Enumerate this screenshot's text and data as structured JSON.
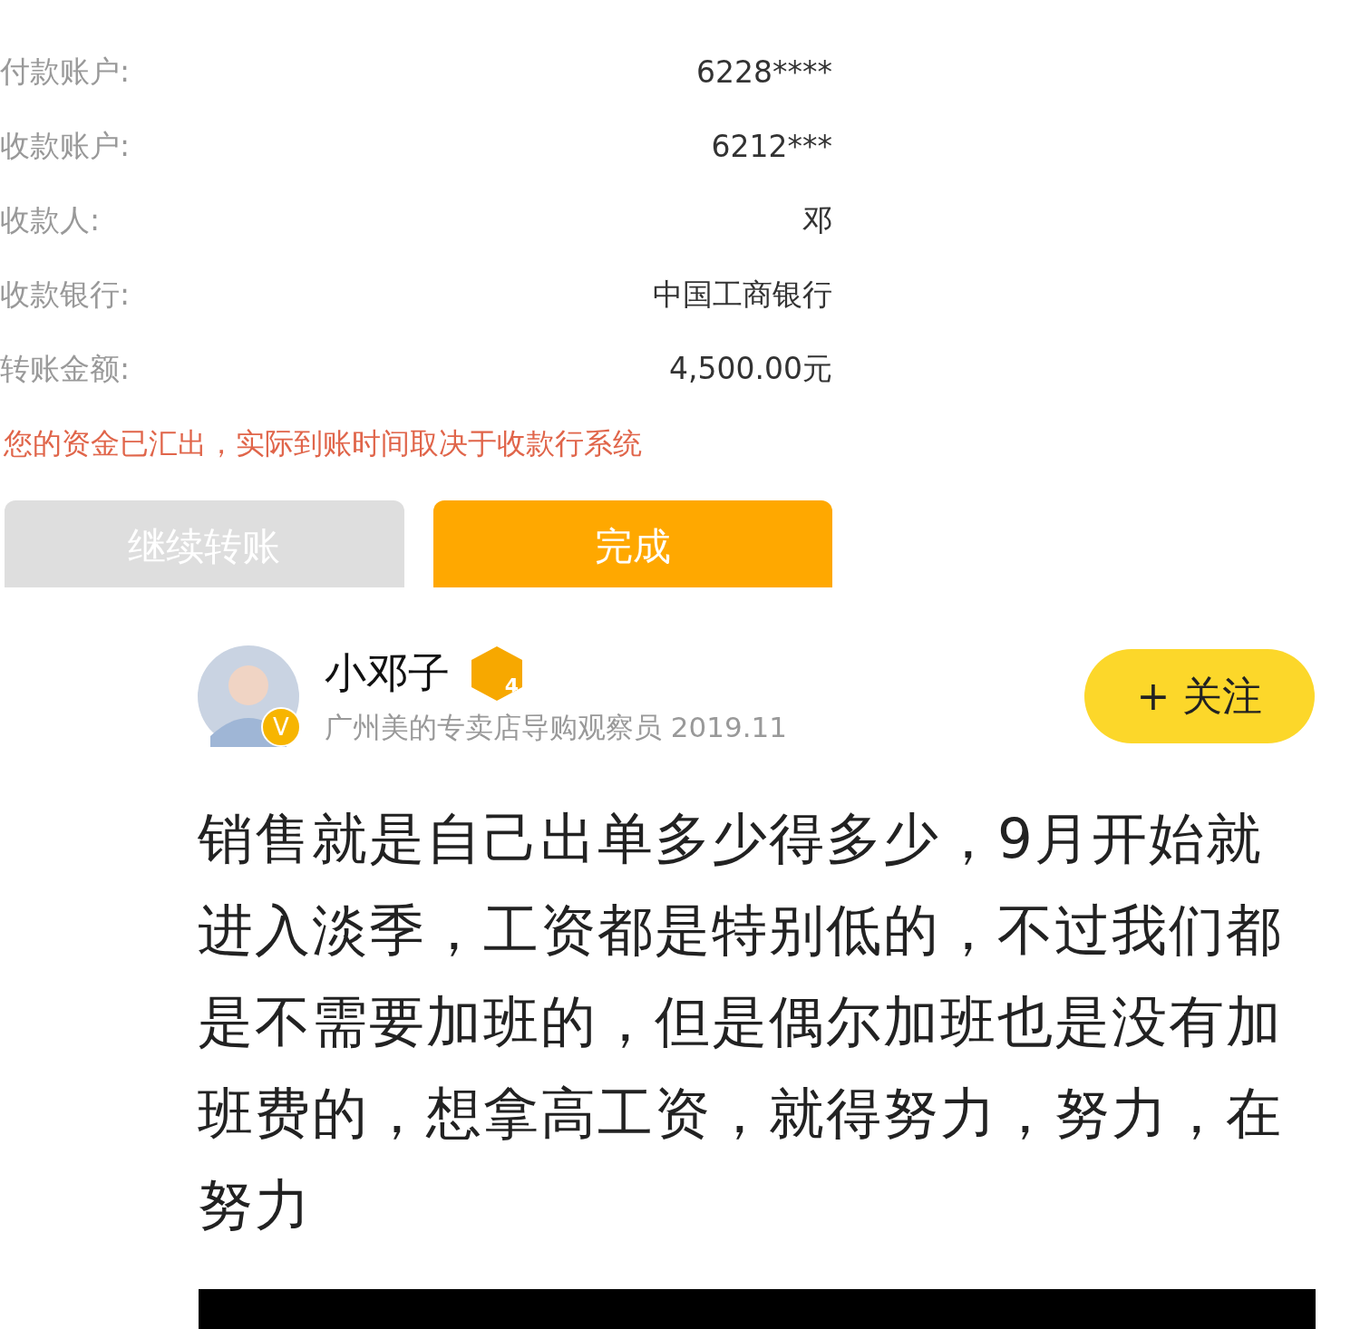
{
  "transfer": {
    "rows": [
      {
        "label": "付款账户:",
        "value": "6228****"
      },
      {
        "label": "收款账户:",
        "value": "6212***"
      },
      {
        "label": "收款人:",
        "value": "邓"
      },
      {
        "label": "收款银行:",
        "value": "中国工商银行"
      },
      {
        "label": "转账金额:",
        "value": "4,500.00元"
      }
    ],
    "notice": "您的资金已汇出，实际到账时间取决于收款行系统",
    "buttons": [
      {
        "label": "继续转账",
        "kind": "secondary"
      },
      {
        "label": "完成",
        "kind": "primary"
      }
    ]
  },
  "post": {
    "author": "小邓子",
    "level": "4",
    "verified_mark": "V",
    "subtitle": "广州美的专卖店导购观察员 2019.11",
    "follow_button": "+ 关注",
    "body": "销售就是自己出单多少得多少，9月开始就进入淡季，工资都是特别低的，不过我们都是不需要加班的，但是偶尔加班也是没有加班费的，想拿高工资，就得努力，努力，在努力"
  }
}
